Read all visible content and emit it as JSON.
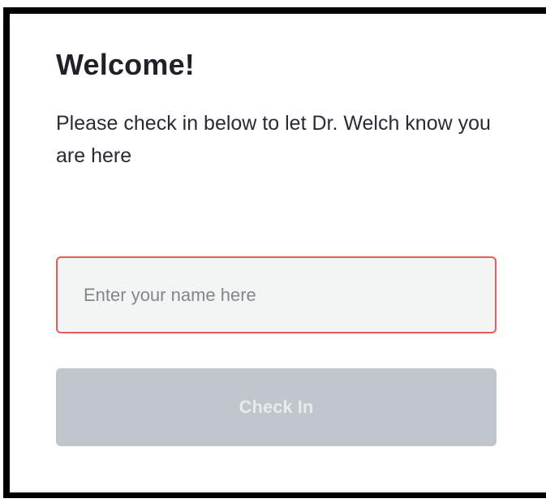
{
  "checkin": {
    "title": "Welcome!",
    "message": "Please check in below to let Dr. Welch know you are here",
    "name_input": {
      "placeholder": "Enter your name here",
      "value": ""
    },
    "button_label": "Check In"
  },
  "colors": {
    "title_text": "#1f2128",
    "input_border_error": "#ec5a5a",
    "input_background": "#f3f4f4",
    "button_disabled_background": "#c1c5cc",
    "button_disabled_text": "#e8eaee"
  }
}
